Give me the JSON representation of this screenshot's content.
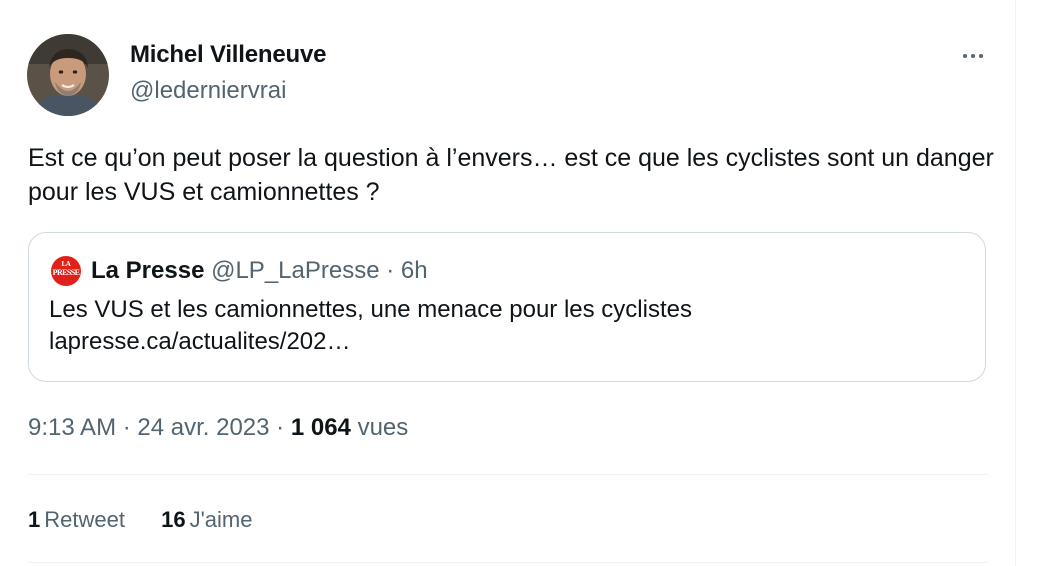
{
  "author": {
    "name": "Michel Villeneuve",
    "handle": "@ledernier​vrai"
  },
  "tweet_text": "Est ce qu’on peut poser la question à l’envers… est ce que les cyclistes sont un danger pour les VUS et camionnettes ?",
  "quoted": {
    "logo_line1": "LA",
    "logo_line2": "PRESSE",
    "name": "La Presse",
    "handle": "@LP_LaPresse",
    "separator": " · ",
    "time": "6h",
    "text_line1": " Les VUS et les camionnettes, une menace pour les cyclistes",
    "text_line2": "lapresse.ca/actualites/202…"
  },
  "meta": {
    "time": "9:13 AM",
    "sep": " · ",
    "date": "24 avr. 2023",
    "views_count": "1 064",
    "views_label": "vues"
  },
  "stats": {
    "retweets_count": "1",
    "retweets_label": "Retweet",
    "likes_count": "16",
    "likes_label": "J'aime"
  },
  "icons": {
    "more": "more-horizontal-icon",
    "quoted_avatar": "la-presse-logo"
  },
  "colors": {
    "text": "#0f1419",
    "secondary": "#536471",
    "border": "#cfd9de",
    "logo_red": "#e0211a"
  }
}
